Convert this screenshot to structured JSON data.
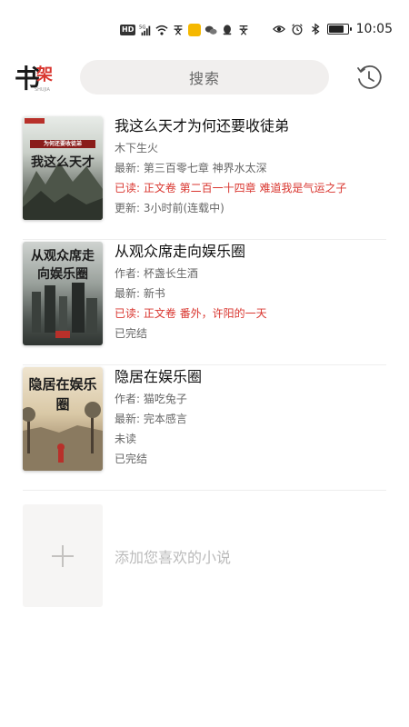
{
  "status_bar": {
    "hd_badge": "HD",
    "network": "5G",
    "time": "10:05",
    "battery_level": 0.85
  },
  "header": {
    "logo_text": "书架",
    "logo_subtext": "SHUJIA",
    "search_placeholder": "搜索"
  },
  "books": [
    {
      "title": "我这么天才为何还要收徒弟",
      "cover_title": "我这么天才",
      "cover_badge": "为何还要收徒弟",
      "line1": "木下生火",
      "line2": "最新: 第三百零七章 神界水太深",
      "line3": "已读: 正文卷 第二百一十四章 难道我是气运之子",
      "line4": "更新: 3小时前(连载中)"
    },
    {
      "title": "从观众席走向娱乐圈",
      "cover_title": "从观众席走向娱乐圈",
      "line1": "作者: 杯盏长生酒",
      "line2": "最新: 新书",
      "line3": "已读: 正文卷 番外，许阳的一天",
      "line4": "已完结"
    },
    {
      "title": "隐居在娱乐圈",
      "cover_title": "隐居在娱乐圈",
      "line1": "作者: 猫吃兔子",
      "line2": "最新: 完本感言",
      "line3": "未读",
      "line4": "已完结"
    }
  ],
  "add_book": {
    "label": "添加您喜欢的小说"
  },
  "colors": {
    "accent_red": "#d9362f",
    "search_bg": "#f1efee"
  }
}
